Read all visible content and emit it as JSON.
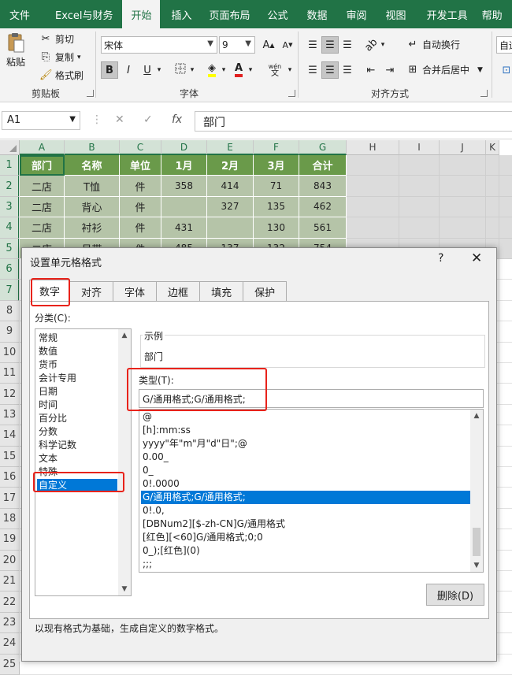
{
  "ribbon_tabs": [
    "文件",
    "Excel与财务",
    "开始",
    "插入",
    "页面布局",
    "公式",
    "数据",
    "审阅",
    "视图",
    "开发工具",
    "帮助"
  ],
  "clipboard": {
    "paste": "粘贴",
    "cut": "剪切",
    "copy": "复制",
    "format_painter": "格式刷",
    "label": "剪贴板"
  },
  "font": {
    "name": "宋体",
    "size": "9",
    "bold": "B",
    "italic": "I",
    "underline": "U",
    "phonetic": "wén",
    "label": "字体"
  },
  "alignment": {
    "wrap_text": "自动换行",
    "merge_center": "合并后居中",
    "label": "对齐方式",
    "auto_cut": "自适"
  },
  "formula_bar": {
    "name_box": "A1",
    "fx": "fx",
    "content": "部门"
  },
  "columns": [
    "A",
    "B",
    "C",
    "D",
    "E",
    "F",
    "G",
    "H",
    "I",
    "J",
    "K"
  ],
  "rows": [
    "1",
    "2",
    "3",
    "4",
    "5",
    "6",
    "7",
    "8",
    "9",
    "10",
    "11",
    "12",
    "13",
    "14",
    "15",
    "16",
    "17",
    "18",
    "19",
    "20",
    "21",
    "22",
    "23",
    "24",
    "25"
  ],
  "table": {
    "headers": [
      "部门",
      "名称",
      "单位",
      "1月",
      "2月",
      "3月",
      "合计"
    ],
    "rows": [
      [
        "二店",
        "T恤",
        "件",
        "358",
        "414",
        "71",
        "843"
      ],
      [
        "二店",
        "背心",
        "件",
        "",
        "327",
        "135",
        "462"
      ],
      [
        "二店",
        "衬衫",
        "件",
        "431",
        "",
        "130",
        "561"
      ],
      [
        "二店",
        "吊带",
        "件",
        "485",
        "137",
        "132",
        "754"
      ]
    ]
  },
  "dialog": {
    "title": "设置单元格格式",
    "help": "?",
    "close": "✕",
    "tabs": [
      "数字",
      "对齐",
      "字体",
      "边框",
      "填充",
      "保护"
    ],
    "category_label": "分类(C):",
    "categories": [
      "常规",
      "数值",
      "货币",
      "会计专用",
      "日期",
      "时间",
      "百分比",
      "分数",
      "科学记数",
      "文本",
      "特殊",
      "自定义"
    ],
    "selected_category": "自定义",
    "sample_label": "示例",
    "sample_value": "部门",
    "type_label": "类型(T):",
    "type_value": "G/通用格式;G/通用格式;",
    "type_list": [
      "@",
      "[h]:mm:ss",
      "yyyy\"年\"m\"月\"d\"日\";@",
      "0.00_",
      "0_",
      "0!.0000",
      "G/通用格式;G/通用格式;",
      "0!.0,",
      "[DBNum2][$-zh-CN]G/通用格式",
      "[红色][<60]G/通用格式;0;0",
      "0_);[红色](0)",
      ";;;"
    ],
    "selected_type": "G/通用格式;G/通用格式;",
    "delete_button": "删除(D)",
    "description": "以现有格式为基础，生成自定义的数字格式。"
  },
  "colors": {
    "excel_green": "#217346",
    "header_fill": "#6a9a4a",
    "data_fill": "#b5c4a8",
    "selection_blue": "#0078d7",
    "highlight_red": "#e8231b"
  }
}
